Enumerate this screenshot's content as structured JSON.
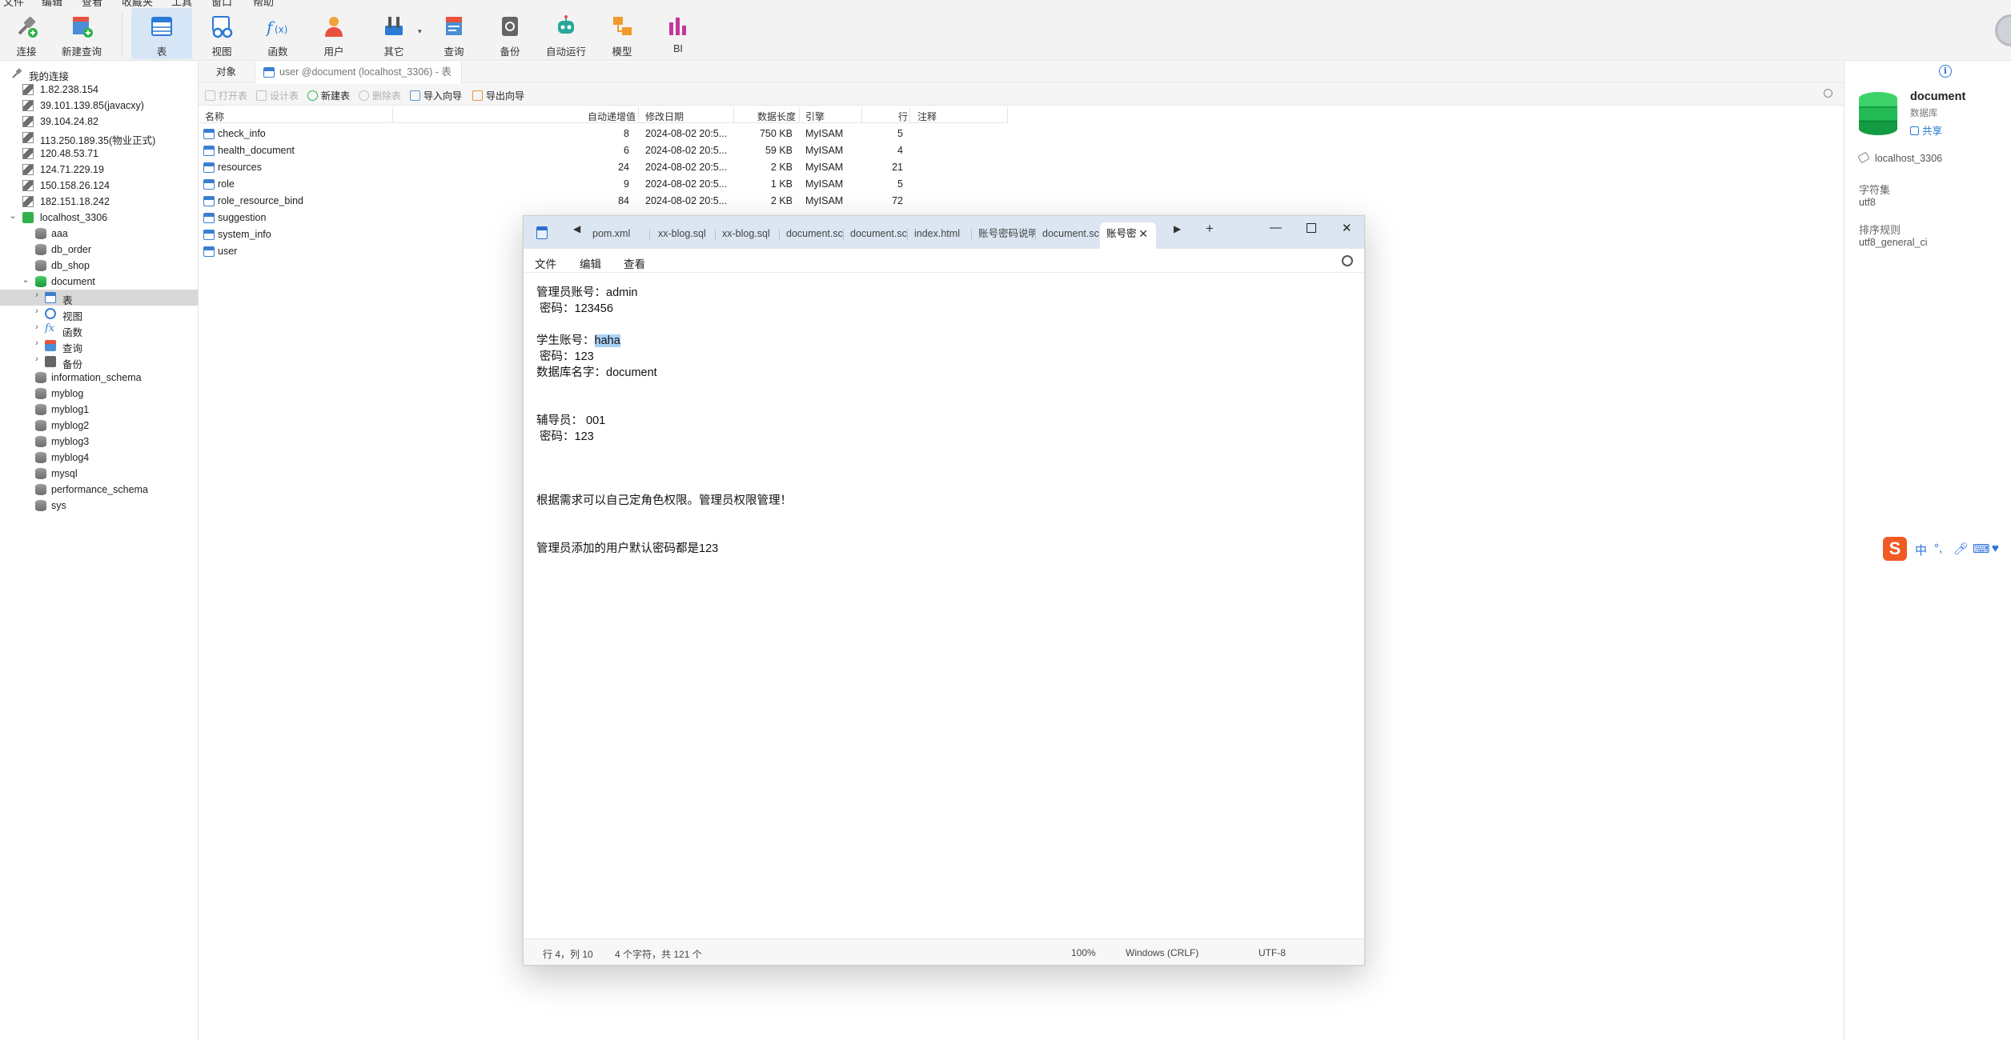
{
  "menubar": [
    "文件",
    "编辑",
    "查看",
    "收藏夹",
    "工具",
    "窗口",
    "帮助"
  ],
  "toolbar": {
    "buttons": [
      {
        "label": "连接",
        "icon": "plug-icon"
      },
      {
        "label": "新建查询",
        "icon": "new-query-icon"
      },
      {
        "label": "表",
        "icon": "table-icon"
      },
      {
        "label": "视图",
        "icon": "view-icon"
      },
      {
        "label": "函数",
        "icon": "function-icon"
      },
      {
        "label": "用户",
        "icon": "user-icon"
      },
      {
        "label": "其它",
        "icon": "tools-icon"
      },
      {
        "label": "查询",
        "icon": "query-icon"
      },
      {
        "label": "备份",
        "icon": "backup-icon"
      },
      {
        "label": "自动运行",
        "icon": "robot-icon"
      },
      {
        "label": "模型",
        "icon": "model-icon"
      },
      {
        "label": "BI",
        "icon": "bi-icon"
      }
    ],
    "active": "表"
  },
  "navigator": {
    "title": "我的连接",
    "connections": [
      "1.82.238.154",
      "39.101.139.85(javacxy)",
      "39.104.24.82",
      "113.250.189.35(物业正式)",
      "120.48.53.71",
      "124.71.229.19",
      "150.158.26.124",
      "182.151.18.242"
    ],
    "open_connection": "localhost_3306",
    "databases_top": [
      "aaa",
      "db_order",
      "db_shop"
    ],
    "open_db": "document",
    "db_children": [
      "表",
      "视图",
      "函数",
      "查询",
      "备份"
    ],
    "databases_bottom": [
      "information_schema",
      "myblog",
      "myblog1",
      "myblog2",
      "myblog3",
      "myblog4",
      "mysql",
      "performance_schema",
      "sys"
    ]
  },
  "object_tabs": [
    "对象",
    "user @document (localhost_3306) - 表"
  ],
  "object_toolbar": {
    "open_table": "打开表",
    "design_table": "设计表",
    "new_table": "新建表",
    "delete_table": "删除表",
    "import_wizard": "导入向导",
    "export_wizard": "导出向导"
  },
  "table_grid": {
    "columns": [
      "名称",
      "自动递增值",
      "修改日期",
      "数据长度",
      "引擎",
      "行",
      "注释"
    ],
    "rows": [
      {
        "name": "check_info",
        "auto_inc": "8",
        "modified": "2024-08-02 20:5...",
        "data_len": "750 KB",
        "engine": "MyISAM",
        "rows": "5"
      },
      {
        "name": "health_document",
        "auto_inc": "6",
        "modified": "2024-08-02 20:5...",
        "data_len": "59 KB",
        "engine": "MyISAM",
        "rows": "4"
      },
      {
        "name": "resources",
        "auto_inc": "24",
        "modified": "2024-08-02 20:5...",
        "data_len": "2 KB",
        "engine": "MyISAM",
        "rows": "21"
      },
      {
        "name": "role",
        "auto_inc": "9",
        "modified": "2024-08-02 20:5...",
        "data_len": "1 KB",
        "engine": "MyISAM",
        "rows": "5"
      },
      {
        "name": "role_resource_bind",
        "auto_inc": "84",
        "modified": "2024-08-02 20:5...",
        "data_len": "2 KB",
        "engine": "MyISAM",
        "rows": "72"
      },
      {
        "name": "suggestion",
        "auto_inc": "",
        "modified": "",
        "data_len": "",
        "engine": "",
        "rows": ""
      },
      {
        "name": "system_info",
        "auto_inc": "",
        "modified": "",
        "data_len": "",
        "engine": "",
        "rows": ""
      },
      {
        "name": "user",
        "auto_inc": "",
        "modified": "",
        "data_len": "",
        "engine": "",
        "rows": ""
      }
    ]
  },
  "info_panel": {
    "db_name": "document",
    "db_type": "数据库",
    "share": "共享",
    "host": "localhost_3306",
    "charset_label": "字符集",
    "charset": "utf8",
    "collation_label": "排序规则",
    "collation": "utf8_general_ci"
  },
  "ime": {
    "lang": "中"
  },
  "notepad": {
    "tabs": [
      "pom.xml",
      "xx-blog.sql",
      "xx-blog.sql",
      "document.sc",
      "document.sc",
      "index.html",
      "账号密码说明",
      "document.sc",
      "账号密"
    ],
    "active_tab": "账号密",
    "menus": [
      "文件",
      "编辑",
      "查看"
    ],
    "lines": [
      "管理员账号：admin",
      " 密码：123456",
      "",
      "学生账号：",
      " 密码：123",
      "数据库名字：document",
      "",
      "",
      "辅导员： 001",
      " 密码：123",
      "",
      "",
      "",
      "根据需求可以自己定角色权限。管理员权限管理！",
      "",
      "",
      "管理员添加的用户默认密码都是123"
    ],
    "selected_text": "haha",
    "status": {
      "position": "行 4，列 10",
      "selection": "4 个字符，共 121 个",
      "zoom": "100%",
      "line_ending": "Windows (CRLF)",
      "encoding": "UTF-8"
    }
  }
}
